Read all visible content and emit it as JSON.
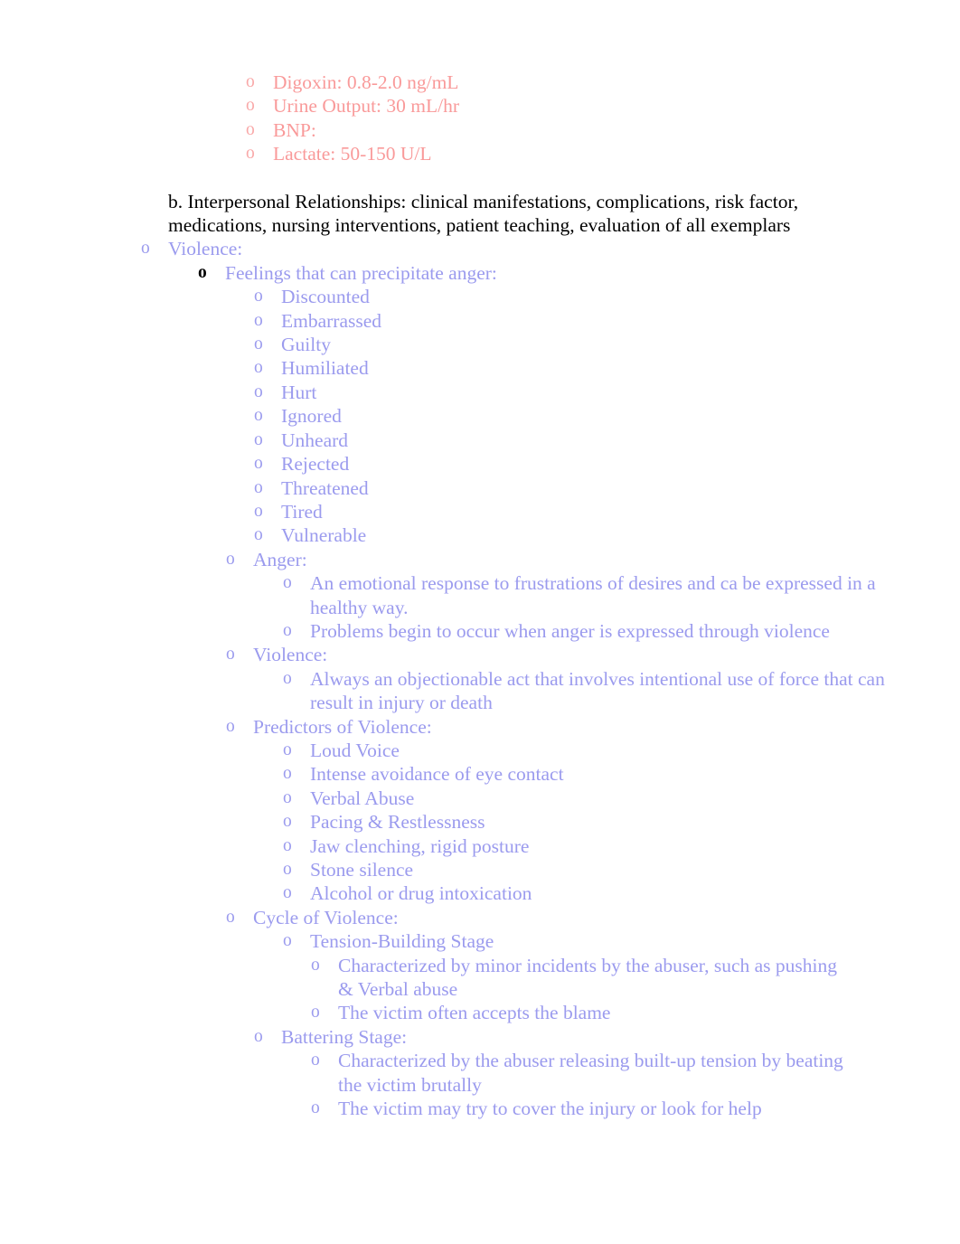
{
  "document": {
    "colors": {
      "red": "#f99a9a",
      "purple": "#9b9bee",
      "black": "#000000",
      "background": "#ffffff"
    },
    "bullet_glyph": "o"
  },
  "lab_values": {
    "items": [
      {
        "bullet": "o",
        "text": "Digoxin: 0.8-2.0 ng/mL"
      },
      {
        "bullet": "o",
        "text": "Urine Output: 30 mL/hr"
      },
      {
        "bullet": "o",
        "text": "BNP:"
      },
      {
        "bullet": "o",
        "text": "Lactate: 50-150 U/L"
      }
    ]
  },
  "section_b": {
    "marker": "b.",
    "text": "Interpersonal Relationships:   clinical manifestations, complications, risk factor, medications, nursing interventions, patient teaching, evaluation of all exemplars"
  },
  "violence": {
    "heading": {
      "bullet": "o",
      "text": "Violence:"
    },
    "feelings_heading": {
      "bullet": "o",
      "text": "Feelings that can precipitate anger:"
    },
    "feelings": [
      {
        "bullet": "o",
        "text": "Discounted"
      },
      {
        "bullet": "o",
        "text": "Embarrassed"
      },
      {
        "bullet": "o",
        "text": "Guilty"
      },
      {
        "bullet": "o",
        "text": "Humiliated"
      },
      {
        "bullet": "o",
        "text": "Hurt"
      },
      {
        "bullet": "o",
        "text": "Ignored"
      },
      {
        "bullet": "o",
        "text": "Unheard"
      },
      {
        "bullet": "o",
        "text": "Rejected"
      },
      {
        "bullet": "o",
        "text": "Threatened"
      },
      {
        "bullet": "o",
        "text": "Tired"
      },
      {
        "bullet": "o",
        "text": "Vulnerable"
      }
    ],
    "anger": {
      "heading": {
        "bullet": "o",
        "text": "Anger:"
      },
      "items": [
        {
          "bullet": "o",
          "text": "An emotional response to frustrations of desires and ca be expressed in a healthy way."
        },
        {
          "bullet": "o",
          "text": "Problems begin to occur when anger is expressed through violence"
        }
      ]
    },
    "violence_def": {
      "heading": {
        "bullet": "o",
        "text": "Violence:"
      },
      "items": [
        {
          "bullet": "o",
          "text": " Always an objectionable act that involves intentional use of force that can result in injury or death"
        }
      ]
    },
    "predictors": {
      "heading": {
        "bullet": "o",
        "text": "Predictors of Violence:"
      },
      "items": [
        {
          "bullet": "o",
          "text": "Loud Voice"
        },
        {
          "bullet": "o",
          "text": "Intense avoidance of eye contact"
        },
        {
          "bullet": "o",
          "text": "Verbal Abuse"
        },
        {
          "bullet": "o",
          "text": "Pacing & Restlessness"
        },
        {
          "bullet": "o",
          "text": "Jaw clenching, rigid posture"
        },
        {
          "bullet": "o",
          "text": "Stone silence"
        },
        {
          "bullet": "o",
          "text": "Alcohol or drug intoxication"
        }
      ]
    },
    "cycle": {
      "heading": {
        "bullet": "o",
        "text": "Cycle of Violence:"
      },
      "tension_stage": {
        "heading": {
          "bullet": "o",
          "text": "Tension-Building Stage"
        },
        "items": [
          {
            "bullet": "o",
            "text": "Characterized by minor incidents by the abuser, such as pushing & Verbal abuse"
          },
          {
            "bullet": "o",
            "text": "The victim often accepts the blame"
          }
        ]
      },
      "battering_stage": {
        "heading": {
          "bullet": "o",
          "text": "Battering Stage:"
        },
        "items": [
          {
            "bullet": "o",
            "text": "Characterized by the abuser releasing built-up tension by beating the victim brutally"
          },
          {
            "bullet": "o",
            "text": "The victim may try to cover the injury or look for help"
          }
        ]
      }
    }
  }
}
